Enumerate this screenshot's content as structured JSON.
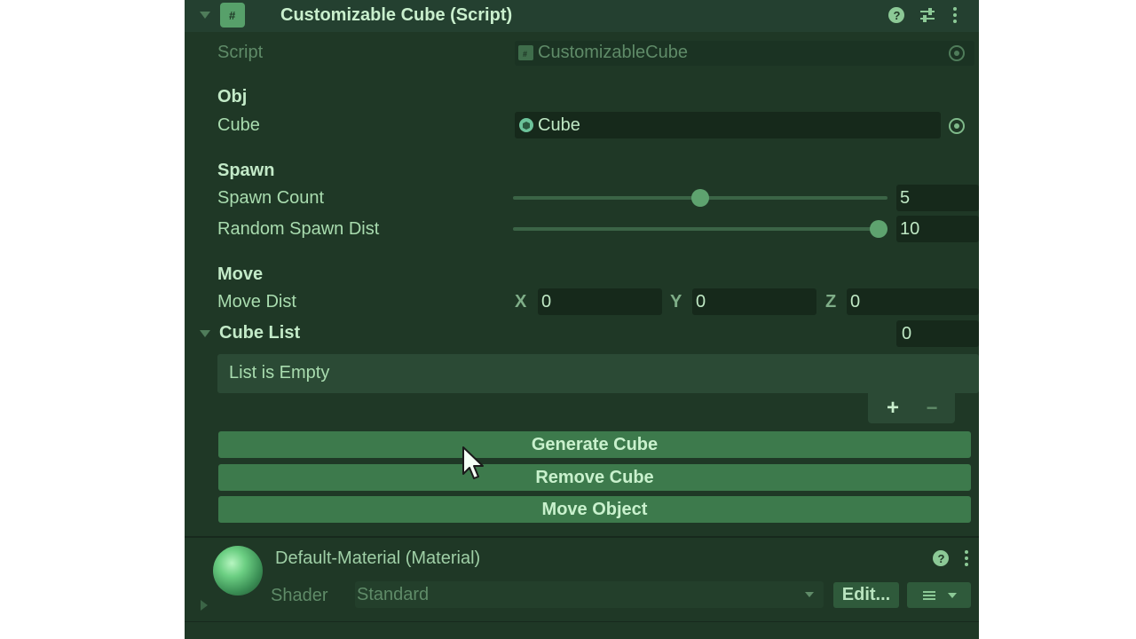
{
  "header": {
    "title": "Customizable Cube (Script)"
  },
  "script_field": {
    "label": "Script",
    "value": "CustomizableCube"
  },
  "obj": {
    "header": "Obj",
    "cube_label": "Cube",
    "cube_value": "Cube"
  },
  "spawn": {
    "header": "Spawn",
    "count_label": "Spawn Count",
    "count_value": "5",
    "count_fraction": 0.5,
    "dist_label": "Random Spawn Dist",
    "dist_value": "10",
    "dist_fraction": 1.0
  },
  "move": {
    "header": "Move",
    "dist_label": "Move Dist",
    "x_label": "X",
    "x_value": "0",
    "y_label": "Y",
    "y_value": "0",
    "z_label": "Z",
    "z_value": "0"
  },
  "cube_list": {
    "label": "Cube List",
    "count": "0",
    "empty_text": "List is Empty",
    "add_label": "+",
    "remove_label": "−"
  },
  "buttons": {
    "generate": "Generate Cube",
    "remove": "Remove Cube",
    "move": "Move Object"
  },
  "material": {
    "title": "Default-Material (Material)",
    "shader_label": "Shader",
    "shader_value": "Standard",
    "edit_label": "Edit..."
  },
  "colors": {
    "panel_bg": "#1f3826",
    "button_bg": "#3d7a4c",
    "accent": "#5ea36f"
  }
}
